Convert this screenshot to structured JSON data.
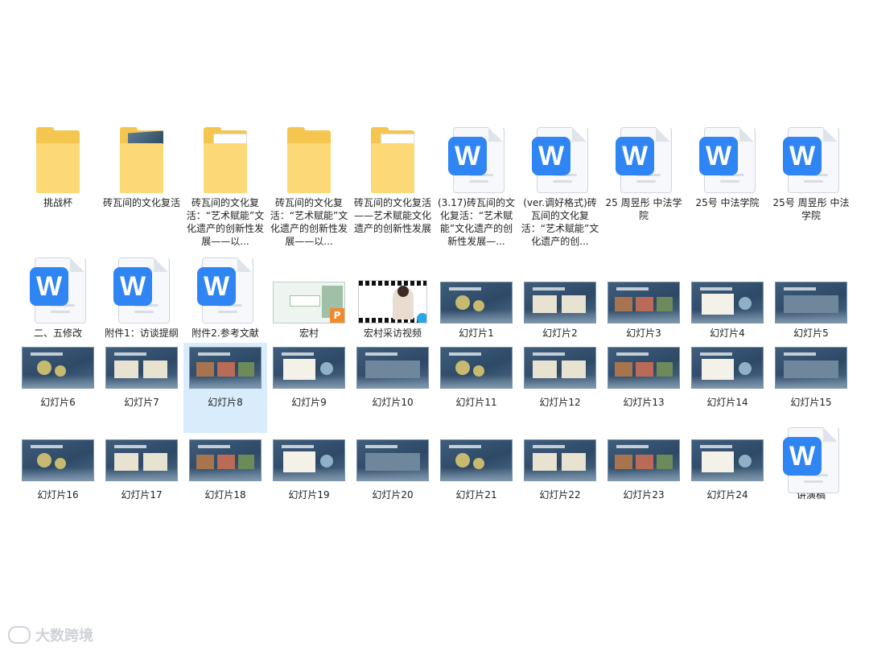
{
  "row1": [
    {
      "type": "folder",
      "label": "挑战杯"
    },
    {
      "type": "folder-photo",
      "label": "砖瓦间的文化复活"
    },
    {
      "type": "folder-w",
      "label": "砖瓦间的文化复活：“艺术赋能”文化遗产的创新性发展——以..."
    },
    {
      "type": "folder",
      "label": "砖瓦间的文化复活：“艺术赋能”文化遗产的创新性发展——以..."
    },
    {
      "type": "folder-p",
      "label": "砖瓦间的文化复活——艺术赋能文化遗产的创新性发展"
    },
    {
      "type": "doc",
      "label": "(3.17)砖瓦间的文化复活：“艺术赋能”文化遗产的创新性发展—..."
    },
    {
      "type": "doc",
      "label": "(ver.调好格式)砖瓦间的文化复活：“艺术赋能”文化遗产的创..."
    },
    {
      "type": "doc",
      "label": "25 周昱彤 中法学院"
    },
    {
      "type": "doc",
      "label": "25号 中法学院"
    },
    {
      "type": "doc",
      "label": "25号 周昱彤 中法学院"
    }
  ],
  "row2": [
    {
      "type": "doc",
      "label": "二、五修改"
    },
    {
      "type": "doc",
      "label": "附件1：访谈提纲"
    },
    {
      "type": "doc",
      "label": "附件2.参考文献"
    },
    {
      "type": "ppt",
      "label": "宏村"
    },
    {
      "type": "video",
      "label": "宏村采访视频"
    },
    {
      "type": "slide",
      "label": "幻灯片1"
    },
    {
      "type": "slide",
      "label": "幻灯片2"
    },
    {
      "type": "slide",
      "label": "幻灯片3"
    },
    {
      "type": "slide",
      "label": "幻灯片4"
    },
    {
      "type": "slide",
      "label": "幻灯片5"
    }
  ],
  "row3": [
    {
      "type": "slide",
      "label": "幻灯片6"
    },
    {
      "type": "slide",
      "label": "幻灯片7"
    },
    {
      "type": "slide",
      "label": "幻灯片8",
      "selected": true
    },
    {
      "type": "slide",
      "label": "幻灯片9"
    },
    {
      "type": "slide",
      "label": "幻灯片10"
    },
    {
      "type": "slide",
      "label": "幻灯片11"
    },
    {
      "type": "slide",
      "label": "幻灯片12"
    },
    {
      "type": "slide",
      "label": "幻灯片13"
    },
    {
      "type": "slide",
      "label": "幻灯片14"
    },
    {
      "type": "slide",
      "label": "幻灯片15"
    }
  ],
  "row4": [
    {
      "type": "slide",
      "label": "幻灯片16"
    },
    {
      "type": "slide",
      "label": "幻灯片17"
    },
    {
      "type": "slide",
      "label": "幻灯片18"
    },
    {
      "type": "slide",
      "label": "幻灯片19"
    },
    {
      "type": "slide",
      "label": "幻灯片20"
    },
    {
      "type": "slide",
      "label": "幻灯片21"
    },
    {
      "type": "slide",
      "label": "幻灯片22"
    },
    {
      "type": "slide",
      "label": "幻灯片23"
    },
    {
      "type": "slide",
      "label": "幻灯片24"
    },
    {
      "type": "doc",
      "label": "讲演稿"
    }
  ],
  "watermark": {
    "text": "大数跨境",
    "icon": "logo-icon"
  },
  "colors": {
    "folder": "#f4c64f",
    "wps_blue": "#2f85f3",
    "slide_bg": "#2d4966",
    "selection": "#d9ecfb"
  }
}
